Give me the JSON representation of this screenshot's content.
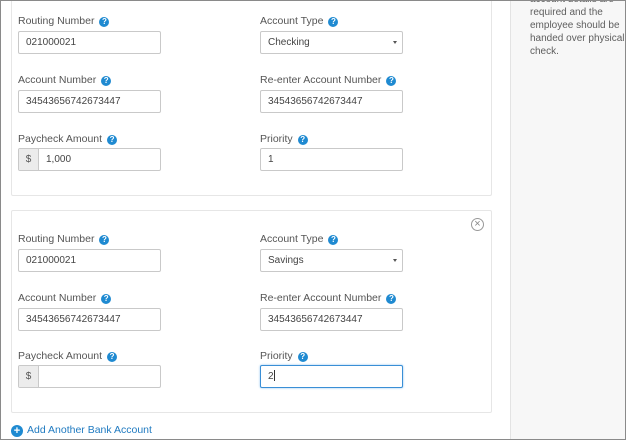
{
  "sidebar": {
    "note": "account details are required and the employee should be handed over physical check."
  },
  "labels": {
    "routing": "Routing Number",
    "account_type": "Account Type",
    "account_number": "Account Number",
    "reenter_account": "Re-enter Account Number",
    "paycheck_amount": "Paycheck Amount",
    "priority": "Priority",
    "currency": "$",
    "help_glyph": "?"
  },
  "accounts": [
    {
      "routing_number": "021000021",
      "account_type": "Checking",
      "account_number": "34543656742673447",
      "reenter_account_number": "34543656742673447",
      "paycheck_amount": "1,000",
      "priority": "1"
    },
    {
      "routing_number": "021000021",
      "account_type": "Savings",
      "account_number": "34543656742673447",
      "reenter_account_number": "34543656742673447",
      "paycheck_amount": "",
      "priority": "2"
    }
  ],
  "add_account_label": "Add Another Bank Account",
  "colors": {
    "accent": "#1f8ad1",
    "link": "#1f7ac0",
    "focus_border": "#3a8fd6"
  }
}
